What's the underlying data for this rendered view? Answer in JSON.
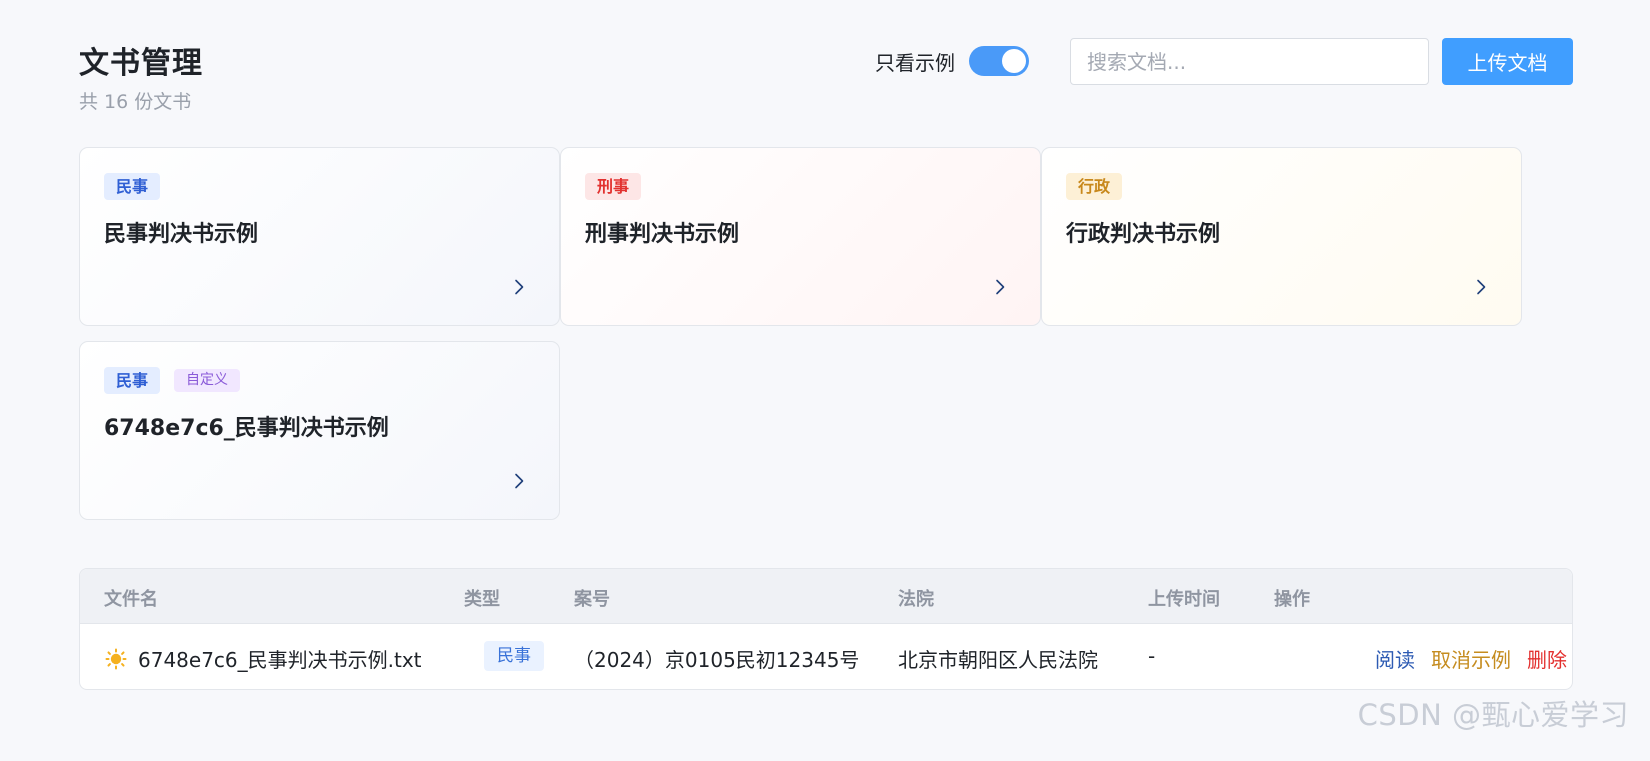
{
  "header": {
    "title": "文书管理",
    "subtitle": "共 16 份文书",
    "toggle_label": "只看示例",
    "toggle_on": true,
    "search_placeholder": "搜索文档...",
    "upload_label": "上传文档"
  },
  "cards": [
    {
      "tags": [
        "民事"
      ],
      "title": "民事判决书示例"
    },
    {
      "tags": [
        "刑事"
      ],
      "title": "刑事判决书示例"
    },
    {
      "tags": [
        "行政"
      ],
      "title": "行政判决书示例"
    },
    {
      "tags": [
        "民事",
        "自定义"
      ],
      "title": "6748e7c6_民事判决书示例"
    }
  ],
  "table": {
    "columns": [
      "文件名",
      "类型",
      "案号",
      "法院",
      "上传时间",
      "操作"
    ],
    "rows": [
      {
        "icon": "sun-icon",
        "filename": "6748e7c6_民事判决书示例.txt",
        "type": "民事",
        "case_no": "（2024）京0105民初12345号",
        "court": "北京市朝阳区人民法院",
        "upload_time": "-",
        "actions": [
          "阅读",
          "取消示例",
          "删除"
        ]
      }
    ]
  },
  "watermark": "CSDN @甄心爱学习",
  "colors": {
    "accent": "#409eff",
    "civil": "#2f5fd4",
    "criminal": "#e2312f",
    "admin": "#c8881b",
    "custom": "#8a5ad8",
    "danger": "#e3302f"
  }
}
